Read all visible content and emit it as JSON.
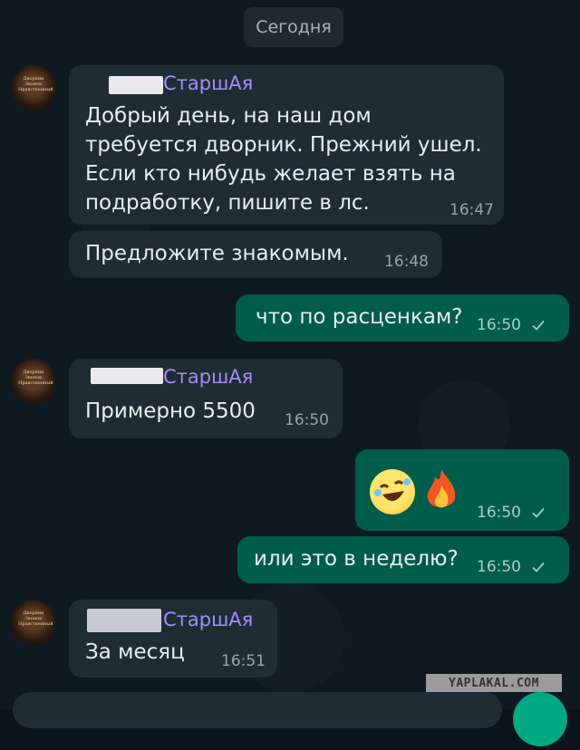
{
  "date_separator": "Сегодня",
  "avatar_caption": "Дворник Звонок Нравственный",
  "messages": [
    {
      "sender": "СтаршАя",
      "text": "Добрый день, на наш дом\nтребуется дворник. Прежний ушел.\nЕсли кто нибудь желает взять на\nподработку, пишите в лс.",
      "time": "16:47"
    },
    {
      "text": "Предложите знакомым.",
      "time": "16:48"
    },
    {
      "text": "что по расценкам?",
      "time": "16:50",
      "outgoing": true
    },
    {
      "sender": "СтаршАя",
      "text": "Примерно 5500",
      "time": "16:50"
    },
    {
      "emoji": "🤣🔥",
      "time": "16:50",
      "outgoing": true
    },
    {
      "text": "или это в неделю?",
      "time": "16:50",
      "outgoing": true
    },
    {
      "sender": "СтаршАя",
      "text": "За месяц",
      "time": "16:51"
    }
  ],
  "watermark": "YAPLAKAL.COM",
  "icons": {
    "read_check": "check-icon",
    "send": "send-icon"
  },
  "colors": {
    "incoming": "#1f2c33",
    "outgoing": "#005c4b",
    "sender_name": "#a78bfa"
  }
}
